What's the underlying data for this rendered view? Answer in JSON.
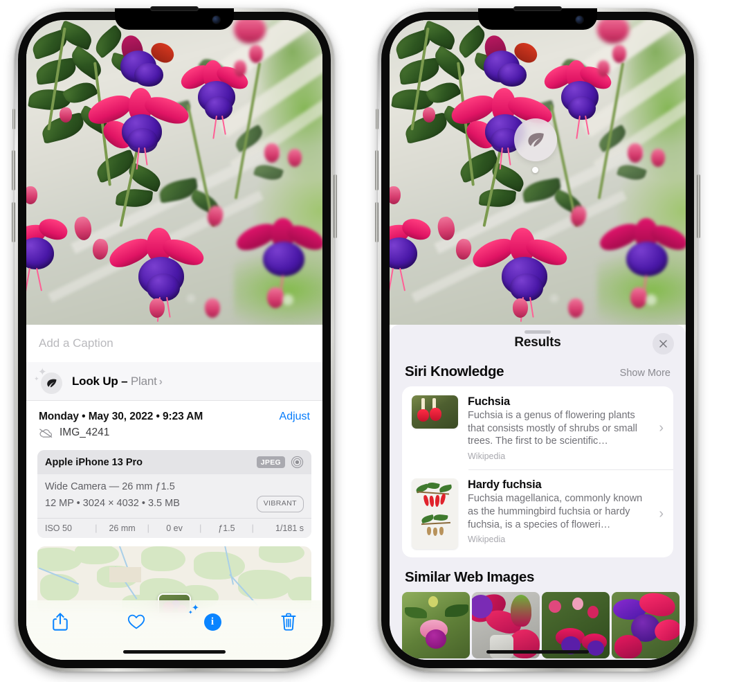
{
  "left_phone": {
    "caption": {
      "placeholder": "Add a Caption",
      "value": ""
    },
    "lookup": {
      "label": "Look Up –",
      "subject": "Plant",
      "chevron": "›",
      "icon": "leaf-icon"
    },
    "meta": {
      "datetime": "Monday • May 30, 2022 • 9:23 AM",
      "adjust_label": "Adjust",
      "filename": "IMG_4241",
      "cloud_icon": "cloud-slash-icon"
    },
    "camera_card": {
      "device": "Apple iPhone 13 Pro",
      "format_badge": "JPEG",
      "raw_icon": "raw-circle-icon",
      "lens_line": "Wide Camera — 26 mm ƒ1.5",
      "size_line": "12 MP • 3024 × 4032 • 3.5 MB",
      "style_badge": "VIBRANT",
      "exif": [
        "ISO 50",
        "26 mm",
        "0 ev",
        "ƒ1.5",
        "1/181 s"
      ]
    },
    "toolbar": [
      {
        "name": "share-button",
        "icon": "share-icon",
        "label": "Share"
      },
      {
        "name": "favorite-button",
        "icon": "heart-icon",
        "label": "Favorite"
      },
      {
        "name": "info-button",
        "icon": "info-sparkle-icon",
        "label": "Info"
      },
      {
        "name": "delete-button",
        "icon": "trash-icon",
        "label": "Delete"
      }
    ]
  },
  "right_phone": {
    "badge": {
      "icon": "leaf-icon"
    },
    "header": {
      "title": "Results",
      "close_label": "×"
    },
    "siri_knowledge": {
      "title": "Siri Knowledge",
      "show_more": "Show More",
      "items": [
        {
          "title": "Fuchsia",
          "description": "Fuchsia is a genus of flowering plants that consists mostly of shrubs or small trees. The first to be scientific…",
          "source": "Wikipedia",
          "chevron": "›"
        },
        {
          "title": "Hardy fuchsia",
          "description": "Fuchsia magellanica, commonly known as the hummingbird fuchsia or hardy fuchsia, is a species of floweri…",
          "source": "Wikipedia",
          "chevron": "›"
        }
      ]
    },
    "similar_web_images": {
      "title": "Similar Web Images",
      "count": 4
    }
  },
  "colors": {
    "accent_blue": "#067cfb",
    "toolbar_blue": "#0a84ff",
    "sheet_bg": "#f0eff5",
    "card_bg": "#ffffff",
    "meta_card_bg": "#f0f0f2",
    "meta_head_bg": "#e4e4e7",
    "secondary_text": "#8e8e93",
    "flower_pink": "#e01464",
    "flower_purple": "#4a18a8"
  }
}
